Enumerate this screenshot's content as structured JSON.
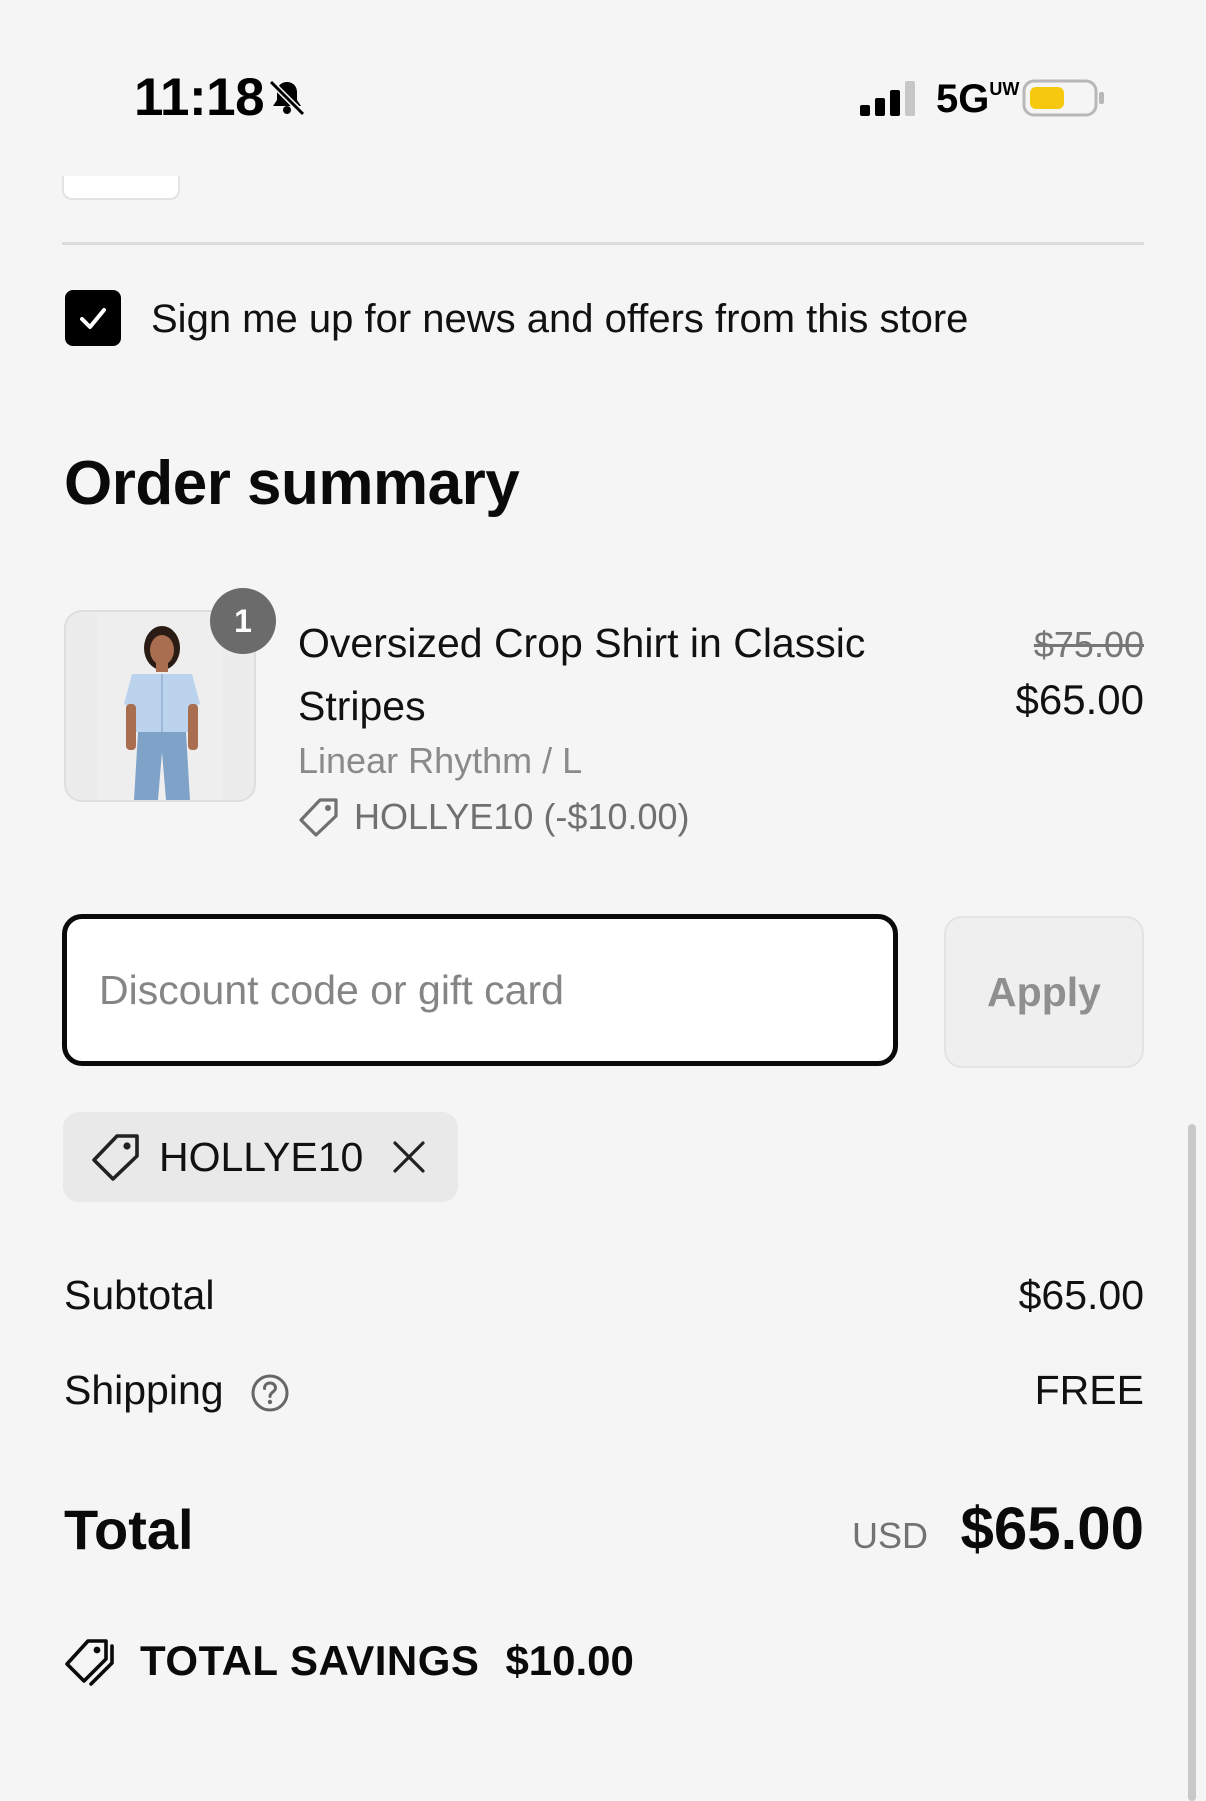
{
  "status_bar": {
    "time": "11:18",
    "network": "5G",
    "network_suffix": "UW",
    "battery_color": "#f6c90e"
  },
  "newsletter": {
    "checked": true,
    "label": "Sign me up for news and offers from this store"
  },
  "order_summary": {
    "title": "Order summary",
    "items": [
      {
        "name": "Oversized Crop Shirt in Classic Stripes",
        "variant": "Linear Rhythm / L",
        "quantity": "1",
        "discount_line": "HOLLYE10 (-$10.00)",
        "original_price": "$75.00",
        "price": "$65.00",
        "image_icon": "product-photo"
      }
    ]
  },
  "discount": {
    "placeholder": "Discount code or gift card",
    "value": "",
    "apply_label": "Apply",
    "applied_code": "HOLLYE10"
  },
  "totals": {
    "subtotal_label": "Subtotal",
    "subtotal_value": "$65.00",
    "shipping_label": "Shipping",
    "shipping_value": "FREE",
    "total_label": "Total",
    "currency": "USD",
    "total_value": "$65.00",
    "savings_label": "TOTAL SAVINGS",
    "savings_value": "$10.00"
  },
  "icons": {
    "bell": "bell-slash-icon",
    "signal": "signal-icon",
    "battery": "battery-icon",
    "check": "check-icon",
    "tag": "tag-icon",
    "close": "close-icon",
    "help": "question-circle-icon",
    "savings": "tags-icon"
  }
}
